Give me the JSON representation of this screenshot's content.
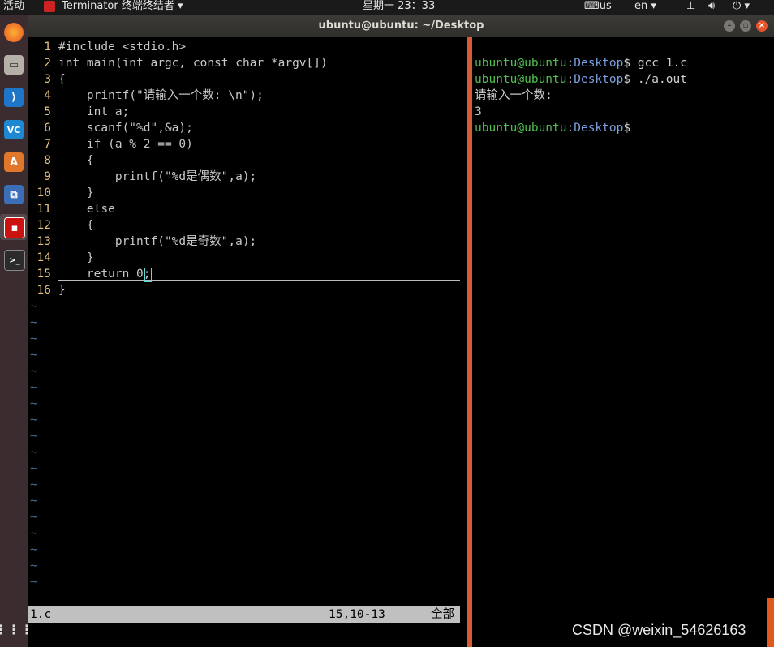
{
  "topbar": {
    "activities": "活动",
    "app_name": "Terminator 终端终结者",
    "clock": "星期一 23：33",
    "keyboard_layout": "us",
    "input_lang": "en",
    "accent_color": "#1a1a1a"
  },
  "window": {
    "title": "ubuntu@ubuntu: ~/Desktop",
    "buttons": [
      "minimize-icon",
      "maximize-icon",
      "close-icon"
    ]
  },
  "dock": {
    "items": [
      "firefox-icon",
      "files-icon",
      "vscode-icon",
      "vs-icon",
      "software-center-icon",
      "network-tools-icon",
      "terminator-icon",
      "terminal-icon"
    ],
    "show_apps_icon": "grid-icon"
  },
  "vim": {
    "lines": [
      {
        "num": "1",
        "text": "#include <stdio.h>"
      },
      {
        "num": "2",
        "text": "int main(int argc, const char *argv[])"
      },
      {
        "num": "3",
        "text": "{"
      },
      {
        "num": "4",
        "text": "    printf(\"请输入一个数: \\n\");"
      },
      {
        "num": "5",
        "text": "    int a;"
      },
      {
        "num": "6",
        "text": "    scanf(\"%d\",&a);"
      },
      {
        "num": "7",
        "text": "    if (a % 2 == 0)"
      },
      {
        "num": "8",
        "text": "    {"
      },
      {
        "num": "9",
        "text": "        printf(\"%d是偶数\",a);"
      },
      {
        "num": "10",
        "text": "    }"
      },
      {
        "num": "11",
        "text": "    else"
      },
      {
        "num": "12",
        "text": "    {"
      },
      {
        "num": "13",
        "text": "        printf(\"%d是奇数\",a);"
      },
      {
        "num": "14",
        "text": "    }"
      },
      {
        "num": "15",
        "text": "    return 0;"
      },
      {
        "num": "16",
        "text": "}"
      }
    ],
    "tilde": "~",
    "status": {
      "filename": "1.c",
      "position": "15,10-13",
      "scroll": "全部"
    }
  },
  "terminal": {
    "prompt_user": "ubuntu@ubuntu",
    "prompt_dir": "Desktop",
    "lines": [
      {
        "cmd": "gcc 1.c"
      },
      {
        "cmd": "./a.out"
      },
      {
        "out": "请输入一个数:"
      },
      {
        "out": "3"
      },
      {
        "cmd": ""
      }
    ]
  },
  "watermark": "CSDN @weixin_54626163"
}
